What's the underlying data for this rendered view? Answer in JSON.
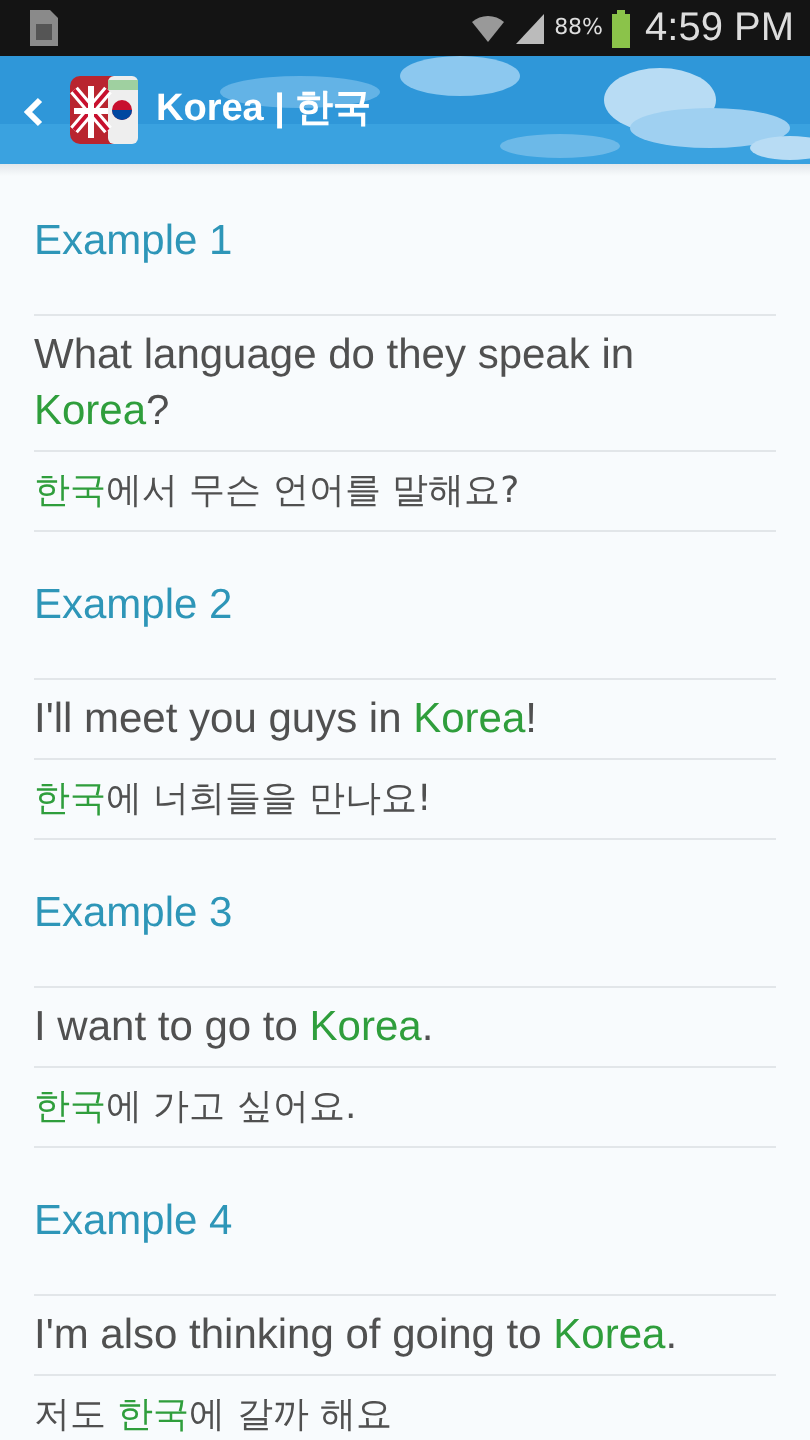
{
  "status_bar": {
    "battery_text": "88%",
    "time": "4:59 PM"
  },
  "action_bar": {
    "title": "Korea | 한국"
  },
  "examples": [
    {
      "heading": "Example 1",
      "sentences": [
        [
          {
            "text": "What language do they speak in "
          },
          {
            "text": "Korea",
            "highlight": true
          },
          {
            "text": "?"
          }
        ],
        [
          {
            "text": "한국",
            "highlight": true
          },
          {
            "text": "에서 무슨 언어를 말해요?"
          }
        ]
      ]
    },
    {
      "heading": "Example 2",
      "sentences": [
        [
          {
            "text": "I'll meet you guys in "
          },
          {
            "text": "Korea",
            "highlight": true
          },
          {
            "text": "!"
          }
        ],
        [
          {
            "text": "한국",
            "highlight": true
          },
          {
            "text": "에 너희들을 만나요!"
          }
        ]
      ]
    },
    {
      "heading": "Example 3",
      "sentences": [
        [
          {
            "text": "I want to go to "
          },
          {
            "text": "Korea",
            "highlight": true
          },
          {
            "text": "."
          }
        ],
        [
          {
            "text": "한국",
            "highlight": true
          },
          {
            "text": "에 가고 싶어요."
          }
        ]
      ]
    },
    {
      "heading": "Example 4",
      "sentences": [
        [
          {
            "text": "I'm also thinking of going to "
          },
          {
            "text": "Korea",
            "highlight": true
          },
          {
            "text": "."
          }
        ],
        [
          {
            "text": "저도 "
          },
          {
            "text": "한국",
            "highlight": true
          },
          {
            "text": "에 갈까 해요"
          }
        ]
      ]
    }
  ]
}
